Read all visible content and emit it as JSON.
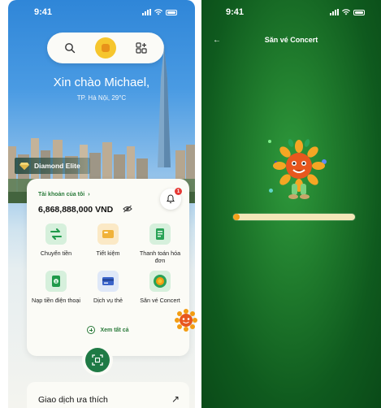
{
  "home": {
    "status": {
      "time": "9:41"
    },
    "greeting": "Xin chào Michael,",
    "location_weather": "TP. Hà Nội, 29°C",
    "tier": "Diamond Elite",
    "account": {
      "label": "Tài khoản của tôi",
      "balance": "6,868,888,000 VND",
      "notification_count": "1"
    },
    "services": [
      {
        "label": "Chuyển tiền",
        "icon": "transfer-icon",
        "color": "#d6f0dc"
      },
      {
        "label": "Tiết kiệm",
        "icon": "savings-icon",
        "color": "#fbe9c6"
      },
      {
        "label": "Thanh toán hóa đơn",
        "icon": "bill-icon",
        "color": "#d6f0dc"
      },
      {
        "label": "Nạp tiền điện thoại",
        "icon": "phone-topup-icon",
        "color": "#d6f0dc"
      },
      {
        "label": "Dịch vụ thẻ",
        "icon": "card-icon",
        "color": "#dfe8f8"
      },
      {
        "label": "Săn vé Concert",
        "icon": "concert-icon",
        "color": "#d6f0dc"
      }
    ],
    "see_all": "Xem tất cả",
    "favorites_title": "Giao dịch ưa thích",
    "favorites_arrow": "↗"
  },
  "concert": {
    "status": {
      "time": "9:41"
    },
    "back_icon": "←",
    "title": "Săn vé Concert",
    "progress_fraction": 0.05
  },
  "colors": {
    "brand_green": "#1f7a45",
    "accent_yellow": "#f6c62e",
    "badge_red": "#e53935"
  }
}
